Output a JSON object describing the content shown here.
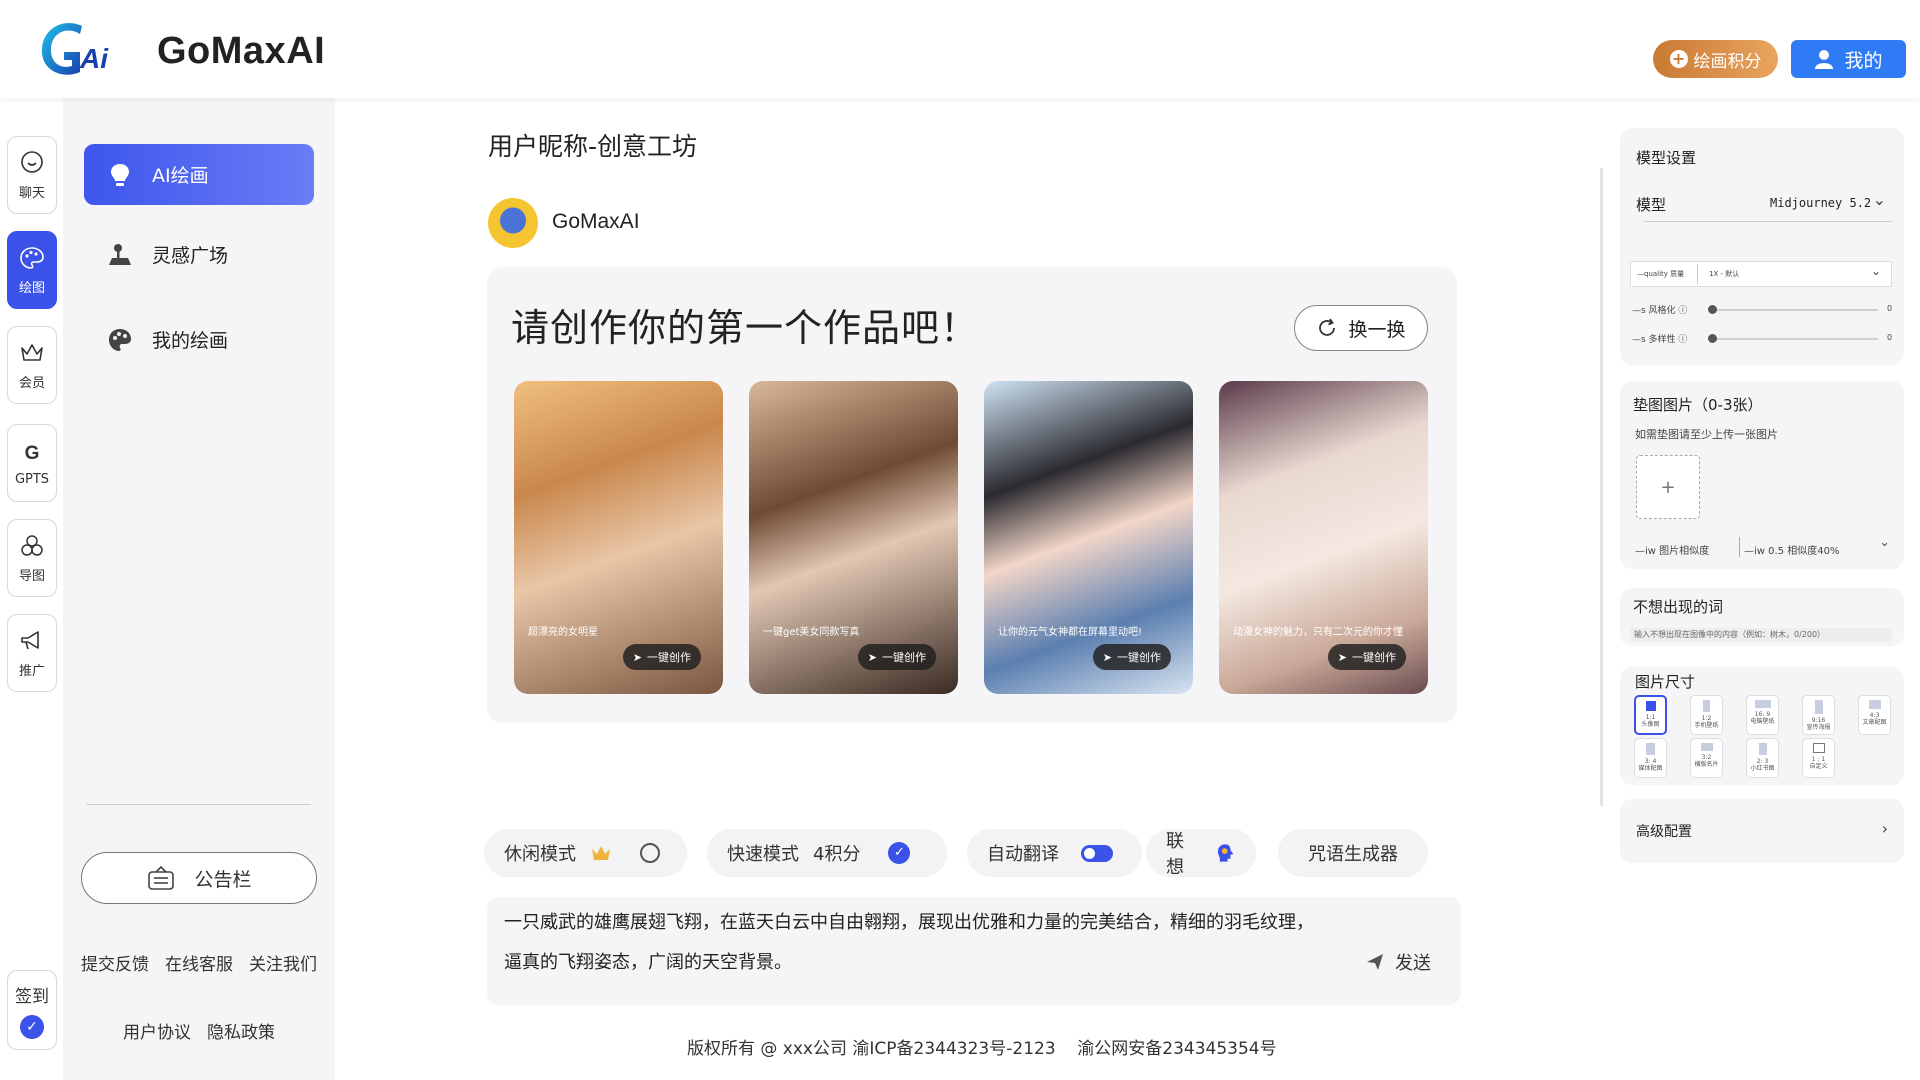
{
  "header": {
    "brand": "GoMaxAI",
    "points_button": "绘画积分",
    "me_button": "我的"
  },
  "rail": [
    {
      "label": "聊天",
      "icon": "chat-icon",
      "active": false
    },
    {
      "label": "绘图",
      "icon": "palette-icon",
      "active": true
    },
    {
      "label": "会员",
      "icon": "crown-icon",
      "active": false
    },
    {
      "label": "GPTS",
      "icon": "gpts-icon",
      "active": false
    },
    {
      "label": "导图",
      "icon": "mindmap-icon",
      "active": false
    },
    {
      "label": "推广",
      "icon": "megaphone-icon",
      "active": false
    }
  ],
  "checkin": {
    "label": "签到"
  },
  "menu": {
    "items": [
      {
        "label": "AI绘画",
        "icon": "bulb-icon",
        "active": true
      },
      {
        "label": "灵感广场",
        "icon": "joystick-icon",
        "active": false
      },
      {
        "label": "我的绘画",
        "icon": "palette-icon",
        "active": false
      }
    ],
    "notice": "公告栏",
    "links_row1": [
      "提交反馈",
      "在线客服",
      "关注我们"
    ],
    "links_row2": [
      "用户协议",
      "隐私政策"
    ]
  },
  "main": {
    "page_title": "用户昵称-创意工坊",
    "bot_name": "GoMaxAI",
    "card_title": "请创作你的第一个作品吧！",
    "refresh_label": "换一换",
    "gallery": [
      {
        "caption": "超漂亮的女明星",
        "action": "一键创作"
      },
      {
        "caption": "一键get美女同款写真",
        "action": "一键创作"
      },
      {
        "caption": "让你的元气女神都在屏幕里动吧!",
        "action": "一键创作"
      },
      {
        "caption": "动漫女神的魅力，只有二次元的你才懂",
        "action": "一键创作"
      }
    ],
    "modes": {
      "relax": "休闲模式",
      "fast": "快速模式",
      "fast_cost": "4积分",
      "translate": "自动翻译",
      "associate": "联想",
      "spell": "咒语生成器"
    },
    "prompt": "一只威武的雄鹰展翅飞翔，在蓝天白云中自由翱翔，展现出优雅和力量的完美结合，精细的羽毛纹理，逼真的飞翔姿态，广阔的天空背景。",
    "send": "发送",
    "copyright": "版权所有 @ xxx公司 渝ICP备2344323号-2123    渝公网安备234345354号"
  },
  "settings": {
    "model_title": "模型设置",
    "model_label": "模型",
    "model_value": "Midjourney 5.2",
    "quality_label": "—quality 质量",
    "quality_value": "1X - 默认",
    "stylize_label": "—s 风格化 ⓘ",
    "stylize_value": "0",
    "chaos_label": "—s 多样性 ⓘ",
    "chaos_value": "0",
    "ref_title": "垫图图片（0-3张）",
    "ref_hint": "如需垫图请至少上传一张图片",
    "upload_plus": "+",
    "iw_label": "—iw 图片相似度",
    "iw_value": "—iw 0.5 相似度40%",
    "negative_title": "不想出现的词",
    "negative_placeholder": "输入不想出现在图像中的内容（例如：树木，0/200）",
    "size_title": "图片尺寸",
    "sizes": [
      {
        "ratio": "1:1",
        "name": "头像图"
      },
      {
        "ratio": "1:2",
        "name": "手机壁纸"
      },
      {
        "ratio": "16: 9",
        "name": "电脑壁纸"
      },
      {
        "ratio": "9:16",
        "name": "宣传海报"
      },
      {
        "ratio": "4:3",
        "name": "文章配图"
      },
      {
        "ratio": "3: 4",
        "name": "媒体配图"
      },
      {
        "ratio": "3:2",
        "name": "横版名片"
      },
      {
        "ratio": "2: 3",
        "name": "小红书图"
      },
      {
        "ratio": "1 : 1",
        "name": "自定义"
      }
    ],
    "advanced": "高级配置"
  },
  "colors": {
    "accent": "#3b52e8",
    "points": "#d48a45",
    "me": "#2f7bf6"
  }
}
